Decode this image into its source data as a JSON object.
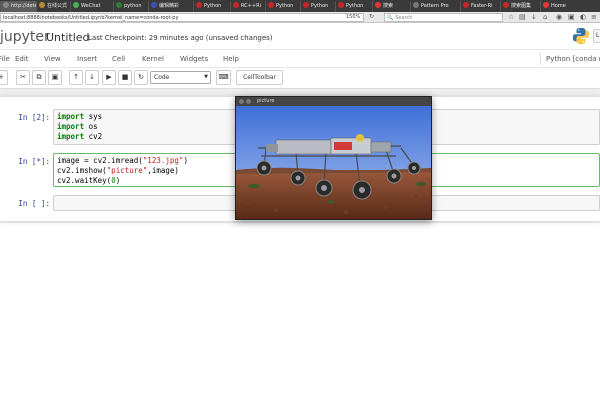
{
  "browser": {
    "tabs": [
      {
        "label": "http://detec",
        "color": "#888888"
      },
      {
        "label": "在线公式",
        "color": "#b58a3c"
      },
      {
        "label": "WeChat",
        "color": "#4caf50"
      },
      {
        "label": "python",
        "color": "#2e7d32"
      },
      {
        "label": "编辑精彩",
        "color": "#3f51b5"
      },
      {
        "label": "Python",
        "color": "#c62828"
      },
      {
        "label": "RC++Ri",
        "color": "#c62828"
      },
      {
        "label": "Python",
        "color": "#c62828"
      },
      {
        "label": "Python",
        "color": "#c62828"
      },
      {
        "label": "Python",
        "color": "#c62828"
      },
      {
        "label": "搜索",
        "color": "#e53935"
      },
      {
        "label": "Pattern Pro",
        "color": "#777777"
      },
      {
        "label": "Faster-Ri",
        "color": "#c62828"
      },
      {
        "label": "搜索图集",
        "color": "#c62828"
      },
      {
        "label": "Home",
        "color": "#e53935"
      }
    ],
    "url": "localhost:8888/notebooks/Untitled.ipynb?kernel_name=conda-root-py",
    "zoom": "150%",
    "search_placeholder": "Search",
    "icons": [
      "star-icon",
      "bookmark-icon",
      "download-icon",
      "home-icon",
      "extension-icon",
      "menu-icon"
    ]
  },
  "notebook": {
    "logo_text": "jupyter",
    "title": "Untitled",
    "checkpoint": "Last Checkpoint: 29 minutes ago (unsaved changes)",
    "logout_label": "L",
    "menus": [
      "File",
      "Edit",
      "View",
      "Insert",
      "Cell",
      "Kernel",
      "Widgets",
      "Help"
    ],
    "kernel": "Python [conda root]",
    "cell_type": "Code",
    "celltoolbar_label": "CellToolbar",
    "toolbar_icons": [
      "save-icon",
      "insert-cell-icon",
      "cut-icon",
      "copy-icon",
      "paste-icon",
      "move-up-icon",
      "move-down-icon",
      "run-icon",
      "stop-icon",
      "restart-icon",
      "keyboard-icon"
    ],
    "cells": [
      {
        "prompt": "In [2]:",
        "lines": [
          "import sys",
          "import os",
          "import cv2"
        ]
      },
      {
        "prompt": "In [*]:",
        "lines": [
          "image = cv2.imread(\"123.jpg\")",
          "cv2.imshow(\"picture\",image)",
          "cv2.waitKey(0)"
        ]
      },
      {
        "prompt": "In [ ]:",
        "lines": [
          ""
        ]
      }
    ]
  },
  "cv_window": {
    "title": "picture",
    "image_subject": "robotic rover on red desert under blue sky"
  }
}
